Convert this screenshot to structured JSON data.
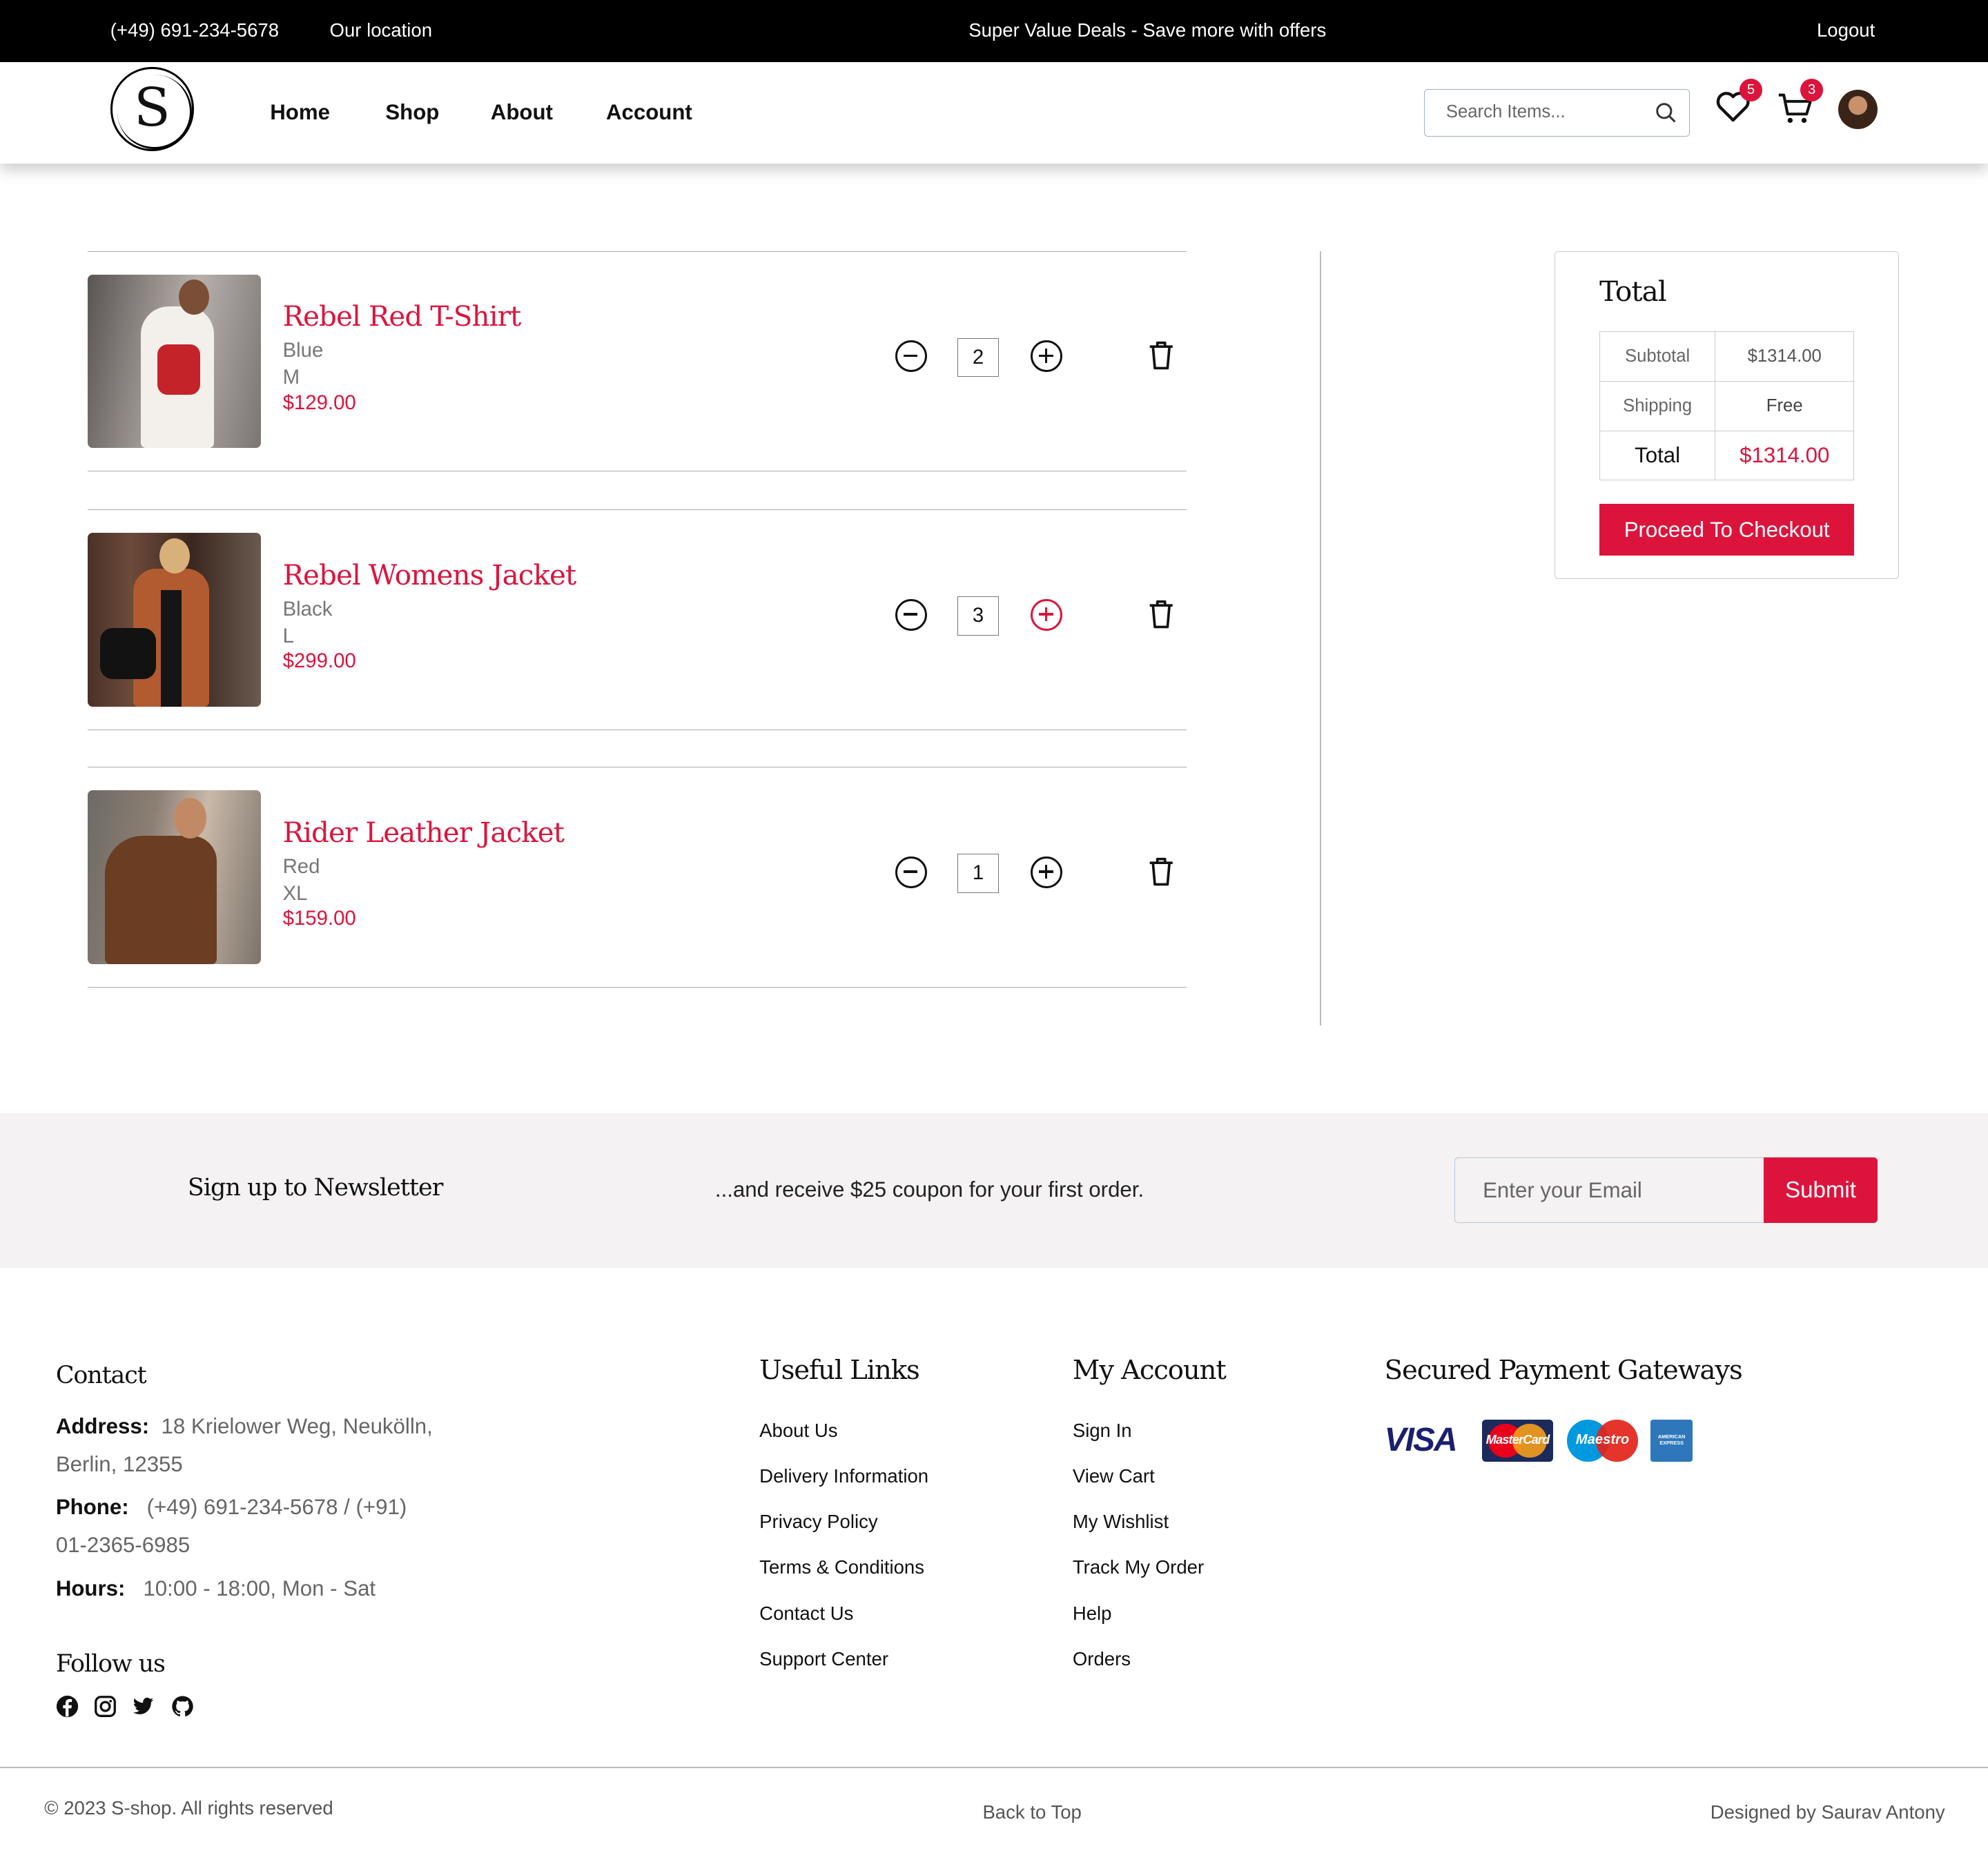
{
  "topbar": {
    "phone": "(+49)  691-234-5678",
    "location": "Our location",
    "promo": "Super Value Deals - Save more with offers",
    "logout": "Logout"
  },
  "header": {
    "logo_letter": "S",
    "nav": [
      "Home",
      "Shop",
      "About",
      "Account"
    ],
    "search_placeholder": "Search Items...",
    "wishlist_count": "5",
    "cart_count": "3"
  },
  "cart": {
    "items": [
      {
        "name": "Rebel Red T-Shirt",
        "color": "Blue",
        "size": "M",
        "price": "$129.00",
        "qty": "2"
      },
      {
        "name": "Rebel Womens Jacket",
        "color": "Black",
        "size": "L",
        "price": "$299.00",
        "qty": "3"
      },
      {
        "name": "Rider Leather Jacket",
        "color": "Red",
        "size": "XL",
        "price": "$159.00",
        "qty": "1"
      }
    ]
  },
  "summary": {
    "title": "Total",
    "rows": [
      {
        "label": "Subtotal",
        "value": "$1314.00"
      },
      {
        "label": "Shipping",
        "value": "Free"
      },
      {
        "label": "Total",
        "value": "$1314.00"
      }
    ],
    "checkout": "Proceed To Checkout"
  },
  "newsletter": {
    "title": "Sign up to Newsletter",
    "text": "...and receive $25 coupon for your first order.",
    "placeholder": "Enter your Email",
    "submit": "Submit"
  },
  "footer": {
    "contact": {
      "title": "Contact",
      "address_label": "Address:",
      "address": "18 Krielower Weg, Neukölln, Berlin, 12355",
      "phone_label": "Phone:",
      "phone": "(+49)  691-234-5678 / (+91)  01-2365-6985",
      "hours_label": "Hours:",
      "hours": "10:00 - 18:00, Mon - Sat"
    },
    "follow_title": "Follow us",
    "useful_title": "Useful Links",
    "useful": [
      "About Us",
      "Delivery Information",
      "Privacy Policy",
      "Terms & Conditions",
      "Contact Us",
      "Support Center"
    ],
    "account_title": "My Account",
    "account": [
      "Sign In",
      "View Cart",
      "My Wishlist",
      "Track My Order",
      "Help",
      "Orders"
    ],
    "payment_title": "Secured Payment Gateways",
    "payment_logos": [
      "VISA",
      "MasterCard",
      "Maestro",
      "AMERICAN EXPRESS"
    ],
    "copyright": "© 2023   S-shop.   All rights reserved",
    "back_to_top": "Back to Top",
    "designed_by": "Designed by Saurav Antony"
  },
  "colors": {
    "accent": "#dc143c",
    "topbar": "#000000",
    "newsletter_bg": "#f4f2f2"
  }
}
